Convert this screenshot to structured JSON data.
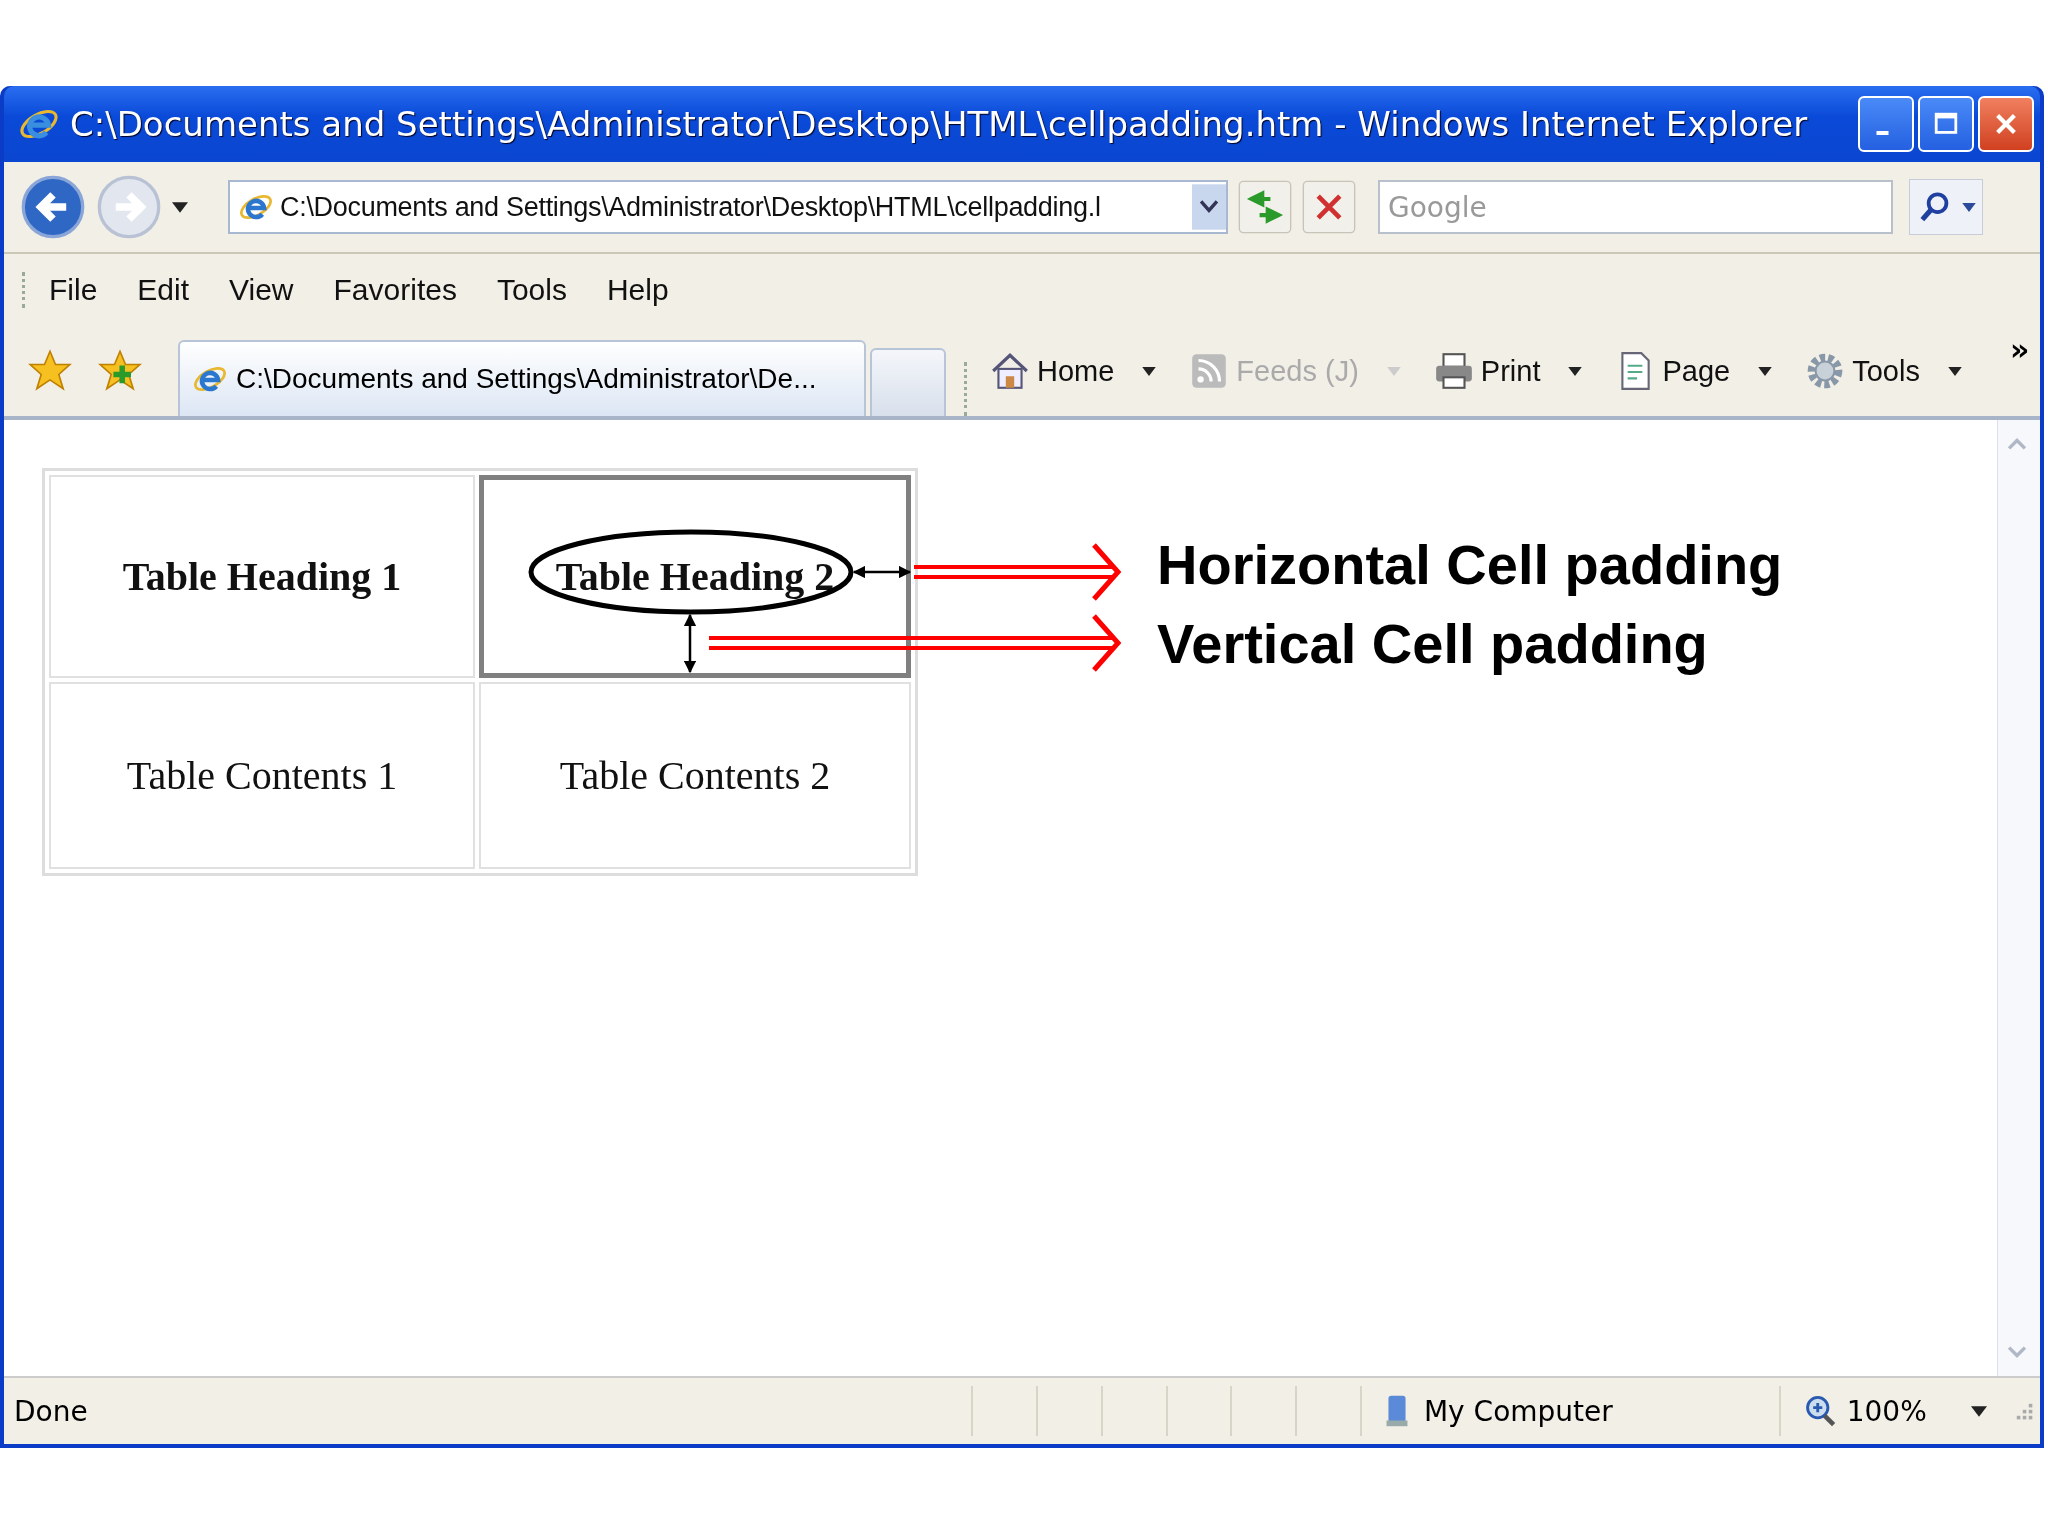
{
  "window": {
    "title": "C:\\Documents and Settings\\Administrator\\Desktop\\HTML\\cellpadding.htm - Windows Internet Explorer"
  },
  "address_bar": {
    "value": "C:\\Documents and Settings\\Administrator\\Desktop\\HTML\\cellpadding.l"
  },
  "search": {
    "placeholder": "Google"
  },
  "menu": [
    "File",
    "Edit",
    "View",
    "Favorites",
    "Tools",
    "Help"
  ],
  "tabs": [
    {
      "label": "C:\\Documents and Settings\\Administrator\\De...",
      "selected": true
    }
  ],
  "command_bar": [
    {
      "kind": "home",
      "label": "Home",
      "disabled": false
    },
    {
      "kind": "feeds",
      "label": "Feeds (J)",
      "disabled": true
    },
    {
      "kind": "print",
      "label": "Print",
      "disabled": false
    },
    {
      "kind": "page",
      "label": "Page",
      "disabled": false
    },
    {
      "kind": "tools",
      "label": "Tools",
      "disabled": false
    }
  ],
  "overflow": "»",
  "table": {
    "rows": [
      [
        {
          "text": "Table Heading 1",
          "header": true,
          "highlighted": false
        },
        {
          "text": "Table Heading 2",
          "header": true,
          "highlighted": true
        }
      ],
      [
        {
          "text": "Table Contents 1",
          "header": false,
          "highlighted": false
        },
        {
          "text": "Table Contents 2",
          "header": false,
          "highlighted": false
        }
      ]
    ]
  },
  "annotations": [
    "Horizontal Cell padding",
    "Vertical Cell padding"
  ],
  "status_bar": {
    "status": "Done",
    "zone": "My Computer",
    "zoom": "100%"
  }
}
